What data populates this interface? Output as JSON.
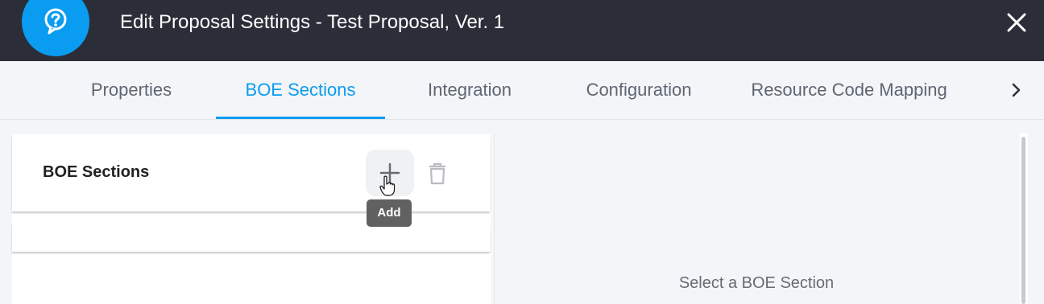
{
  "header": {
    "title": "Edit Proposal Settings - Test Proposal, Ver. 1",
    "help_icon": "help-icon",
    "close_icon": "close-icon",
    "accent_color": "#0a9cf0",
    "background_color": "#2b2e38"
  },
  "tabs": [
    {
      "label": "Properties",
      "active": false
    },
    {
      "label": "BOE Sections",
      "active": true
    },
    {
      "label": "Integration",
      "active": false
    },
    {
      "label": "Configuration",
      "active": false
    },
    {
      "label": "Resource Code Mapping",
      "active": false
    }
  ],
  "tab_scroll_icon": "chevron-right-icon",
  "sections_panel": {
    "title": "BOE Sections",
    "add_icon": "plus-icon",
    "delete_icon": "trash-icon",
    "add_tooltip": "Add"
  },
  "detail_panel": {
    "placeholder": "Select a BOE Section"
  }
}
